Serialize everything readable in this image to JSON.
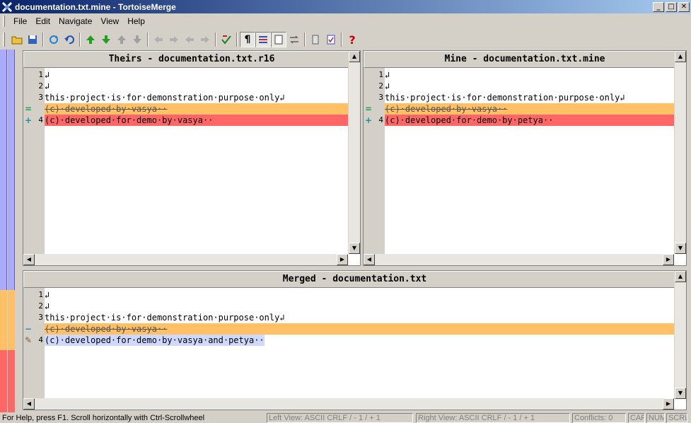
{
  "window": {
    "title": "documentation.txt.mine - TortoiseMerge",
    "minimize": "_",
    "maximize": "□",
    "close": "✕"
  },
  "menu": [
    "File",
    "Edit",
    "Navigate",
    "View",
    "Help"
  ],
  "theirs": {
    "header": "Theirs - documentation.txt.r16",
    "lines": [
      {
        "no": "1",
        "text": "↲",
        "style": ""
      },
      {
        "no": "2",
        "text": "↲",
        "style": ""
      },
      {
        "no": "3",
        "text": "this·project·is·for·demonstration·purpose·only↲",
        "style": ""
      },
      {
        "no": "",
        "text": "(c)·developed·by·vasya··",
        "style": "orange",
        "mark": "="
      },
      {
        "no": "4",
        "text": "(c)·developed·for·demo·by·vasya··",
        "style": "red",
        "mark": "+"
      }
    ]
  },
  "mine": {
    "header": "Mine - documentation.txt.mine",
    "lines": [
      {
        "no": "1",
        "text": "↲",
        "style": ""
      },
      {
        "no": "2",
        "text": "↲",
        "style": ""
      },
      {
        "no": "3",
        "text": "this·project·is·for·demonstration·purpose·only↲",
        "style": ""
      },
      {
        "no": "",
        "text": "(c)·developed·by·vasya··",
        "style": "orange",
        "mark": "="
      },
      {
        "no": "4",
        "text": "(c)·developed·for·demo·by·petya··",
        "style": "red",
        "mark": "+"
      }
    ]
  },
  "merged": {
    "header": "Merged - documentation.txt",
    "lines": [
      {
        "no": "1",
        "text": "↲",
        "style": ""
      },
      {
        "no": "2",
        "text": "↲",
        "style": ""
      },
      {
        "no": "3",
        "text": "this·project·is·for·demonstration·purpose·only↲",
        "style": ""
      },
      {
        "no": "",
        "text": "(c)·developed·by·vasya··",
        "style": "orange",
        "mark": "−"
      },
      {
        "no": "4",
        "text": "(c)·developed·for·demo·by·vasya·and·petya··",
        "style": "edited",
        "mark": "✎"
      }
    ]
  },
  "status": {
    "help": "For Help, press F1. Scroll horizontally with Ctrl-Scrollwheel",
    "left_view": "Left View: ASCII CRLF  / - 1 / + 1",
    "right_view": "Right View: ASCII CRLF  / - 1 / + 1",
    "conflicts": "Conflicts: 0",
    "cap": "CAP",
    "num": "NUM",
    "scrl": "SCRL"
  },
  "colors": {
    "locator": "#aaaaff",
    "removed": "#ffc066",
    "conflict": "#ff6666",
    "edited": "#cfd8ff"
  }
}
